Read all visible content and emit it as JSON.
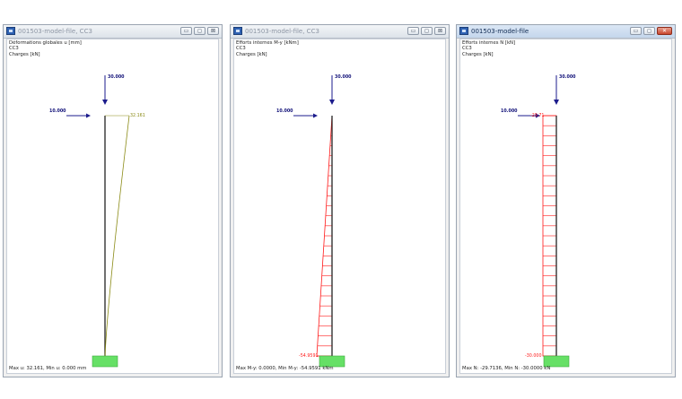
{
  "windows": [
    {
      "title": "001503-model-file, CC3",
      "active": false,
      "buttons": [
        "▭",
        "◻",
        "⊠"
      ],
      "info": [
        "Déformations globales u [mm]",
        "CC3",
        "Charges [kN]"
      ],
      "loads": {
        "vertical": "30.000",
        "horizontal": "10.000"
      },
      "result_label": "32.161",
      "status": "Max u: 32.161, Min u: 0.000 mm",
      "result_type": "deformation"
    },
    {
      "title": "001503-model-file, CC3",
      "active": false,
      "buttons": [
        "▭",
        "◻",
        "⊠"
      ],
      "info": [
        "Efforts internes M-y [kNm]",
        "CC3",
        "Charges [kN]"
      ],
      "loads": {
        "vertical": "30.000",
        "horizontal": "10.000"
      },
      "result_label": "-54.9591",
      "status": "Max M-y: 0.0000, Min M-y: -54.9591 kNm",
      "result_type": "moment"
    },
    {
      "title": "001503-model-file",
      "active": true,
      "buttons": [
        "▭",
        "◻",
        "✕"
      ],
      "info": [
        "Efforts internes N [kN]",
        "CC3",
        "Charges [kN]"
      ],
      "loads": {
        "vertical": "30.000",
        "horizontal": "10.000"
      },
      "result_label_top": "-29.71",
      "result_label": "-30.000",
      "status": "Max N: -29.7136, Min N: -30.0000 kN",
      "result_type": "axial"
    }
  ],
  "colors": {
    "load": "#1b1b8c",
    "member": "#222222",
    "support": "#66e066",
    "deformation": "#8a8a14",
    "internal": "#ff1a1a"
  }
}
